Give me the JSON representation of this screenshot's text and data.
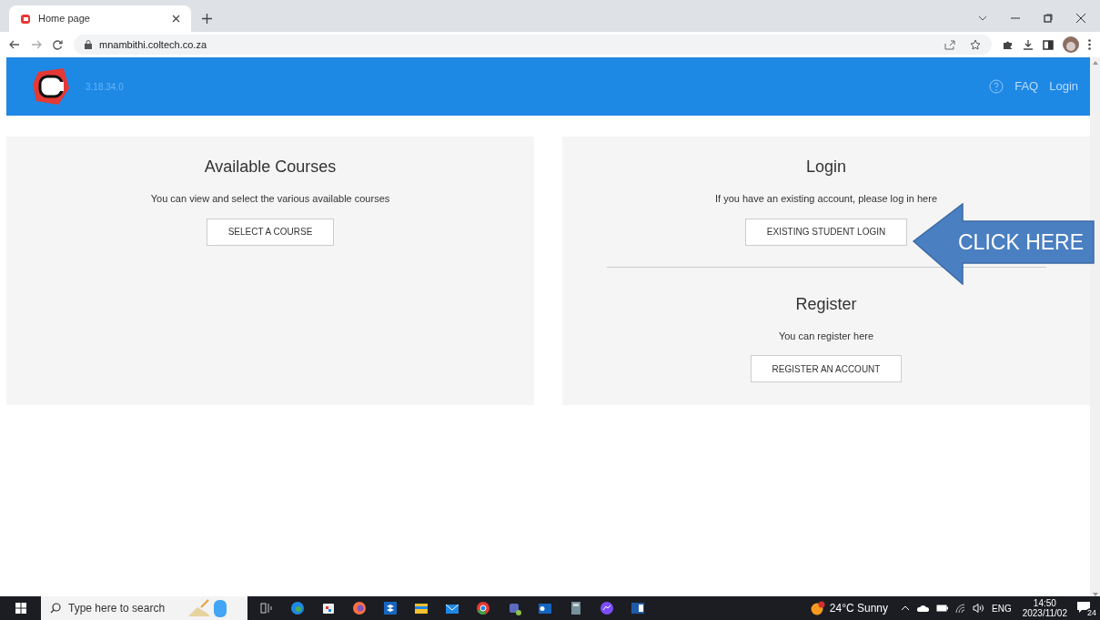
{
  "browser": {
    "tab": {
      "title": "Home page",
      "selected": true
    },
    "url": "mnambithi.coltech.co.za"
  },
  "header": {
    "version": "3.18.34.0",
    "nav": [
      {
        "label": "FAQ",
        "kind": "help"
      },
      {
        "label": "Login",
        "kind": "link"
      }
    ]
  },
  "panels": [
    {
      "sections": [
        {
          "title": "Available Courses",
          "text": "You can view and select the various available courses",
          "button": "SELECT A COURSE"
        }
      ]
    },
    {
      "sections": [
        {
          "title": "Login",
          "text": "If you have an existing account, please log in here",
          "button": "EXISTING STUDENT LOGIN"
        },
        {
          "title": "Register",
          "text": "You can register here",
          "button": "REGISTER AN ACCOUNT"
        }
      ]
    }
  ],
  "callout": {
    "text": "CLICK HERE"
  },
  "taskbar": {
    "search": {
      "placeholder": "Type here to search"
    },
    "weather": "24°C Sunny",
    "language": "ENG",
    "time": "14:50",
    "date": "2023/11/02",
    "notifications": "24"
  }
}
